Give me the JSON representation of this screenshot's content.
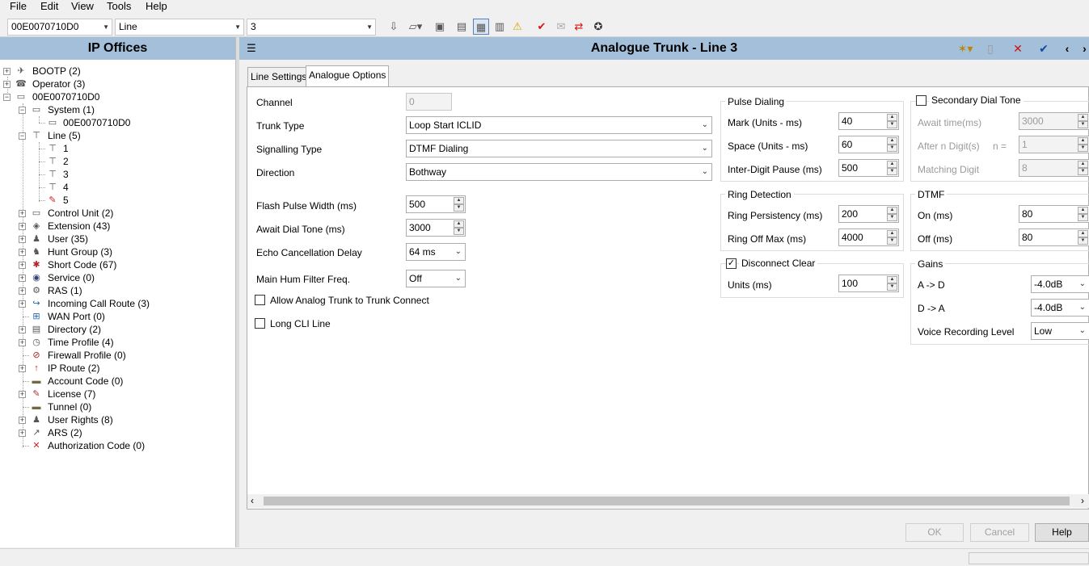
{
  "menu": [
    "File",
    "Edit",
    "View",
    "Tools",
    "Help"
  ],
  "toolbar": {
    "system_select": "00E0070710D0",
    "type_select": "Line",
    "item_select": "3"
  },
  "left_panel": {
    "title": "IP Offices",
    "tree": [
      {
        "label": "BOOTP (2)",
        "icon": "bootp-icon",
        "glyph": "✈"
      },
      {
        "label": "Operator (3)",
        "icon": "operator-icon",
        "glyph": "☎"
      },
      {
        "label": "00E0070710D0",
        "icon": "ip-office-unit-icon",
        "glyph": "▭"
      },
      {
        "label": "System (1)",
        "icon": "system-icon",
        "glyph": "▭"
      },
      {
        "label": "00E0070710D0",
        "icon": "system-unit-icon",
        "glyph": "▭"
      },
      {
        "label": "Line (5)",
        "icon": "line-icon",
        "glyph": "⊤"
      },
      {
        "label": "1",
        "icon": "line-icon",
        "glyph": "⊤"
      },
      {
        "label": "2",
        "icon": "line-icon",
        "glyph": "⊤"
      },
      {
        "label": "3",
        "icon": "line-icon",
        "glyph": "⊤"
      },
      {
        "label": "4",
        "icon": "line-icon",
        "glyph": "⊤"
      },
      {
        "label": "5",
        "icon": "trunk-icon",
        "glyph": "✎"
      },
      {
        "label": "Control Unit (2)",
        "icon": "control-unit-icon",
        "glyph": "▭"
      },
      {
        "label": "Extension (43)",
        "icon": "extension-icon",
        "glyph": "◈"
      },
      {
        "label": "User (35)",
        "icon": "user-icon",
        "glyph": "♟"
      },
      {
        "label": "Hunt Group (3)",
        "icon": "hunt-group-icon",
        "glyph": "♞"
      },
      {
        "label": "Short Code (67)",
        "icon": "short-code-icon",
        "glyph": "✱"
      },
      {
        "label": "Service (0)",
        "icon": "service-icon",
        "glyph": "◉"
      },
      {
        "label": "RAS (1)",
        "icon": "ras-icon",
        "glyph": "⚙"
      },
      {
        "label": "Incoming Call Route (3)",
        "icon": "incoming-call-route-icon",
        "glyph": "↪"
      },
      {
        "label": "WAN Port (0)",
        "icon": "wan-port-icon",
        "glyph": "⊞"
      },
      {
        "label": "Directory (2)",
        "icon": "directory-icon",
        "glyph": "▤"
      },
      {
        "label": "Time Profile (4)",
        "icon": "time-profile-icon",
        "glyph": "◷"
      },
      {
        "label": "Firewall Profile (0)",
        "icon": "firewall-profile-icon",
        "glyph": "⊘"
      },
      {
        "label": "IP Route (2)",
        "icon": "ip-route-icon",
        "glyph": "↑"
      },
      {
        "label": "Account Code (0)",
        "icon": "account-code-icon",
        "glyph": "▬"
      },
      {
        "label": "License (7)",
        "icon": "license-icon",
        "glyph": "✎"
      },
      {
        "label": "Tunnel (0)",
        "icon": "tunnel-icon",
        "glyph": "▬"
      },
      {
        "label": "User Rights (8)",
        "icon": "user-rights-icon",
        "glyph": "♟"
      },
      {
        "label": "ARS (2)",
        "icon": "ars-icon",
        "glyph": "↗"
      },
      {
        "label": "Authorization Code (0)",
        "icon": "authorization-code-icon",
        "glyph": "✕"
      }
    ]
  },
  "right_panel": {
    "title": "Analogue Trunk - Line 3",
    "tabs": [
      "Line Settings",
      "Analogue Options"
    ],
    "fields": {
      "channel": {
        "label": "Channel",
        "value": "0"
      },
      "trunk_type": {
        "label": "Trunk Type",
        "value": "Loop Start ICLID"
      },
      "signalling_type": {
        "label": "Signalling Type",
        "value": "DTMF Dialing"
      },
      "direction": {
        "label": "Direction",
        "value": "Bothway"
      },
      "flash_pulse": {
        "label": "Flash Pulse Width (ms)",
        "value": "500"
      },
      "await_dial_tone": {
        "label": "Await Dial Tone (ms)",
        "value": "3000"
      },
      "echo_cancel": {
        "label": "Echo Cancellation Delay",
        "value": "64 ms"
      },
      "hum_filter": {
        "label": "Main Hum Filter Freq.",
        "value": "Off"
      },
      "allow_analog": {
        "label": "Allow Analog Trunk to Trunk Connect"
      },
      "long_cli": {
        "label": "Long CLI Line"
      }
    },
    "pulse_dialing": {
      "title": "Pulse Dialing",
      "mark_label": "Mark (Units - ms)",
      "mark_value": "40",
      "space_label": "Space (Units - ms)",
      "space_value": "60",
      "inter_digit_label": "Inter-Digit Pause (ms)",
      "inter_digit_value": "500"
    },
    "ring_detection": {
      "title": "Ring Detection",
      "persistency_label": "Ring Persistency (ms)",
      "persistency_value": "200",
      "off_max_label": "Ring Off Max (ms)",
      "off_max_value": "4000"
    },
    "disconnect_clear": {
      "title": "Disconnect Clear",
      "units_label": "Units (ms)",
      "units_value": "100"
    },
    "secondary_dial_tone": {
      "title": "Secondary Dial Tone",
      "await_label": "Await time(ms)",
      "await_value": "3000",
      "after_label": "After n Digit(s)",
      "n_label": "n =",
      "after_value": "1",
      "matching_label": "Matching Digit",
      "matching_value": "8"
    },
    "dtmf": {
      "title": "DTMF",
      "on_label": "On (ms)",
      "on_value": "80",
      "off_label": "Off (ms)",
      "off_value": "80"
    },
    "gains": {
      "title": "Gains",
      "a_to_d_label": "A -> D",
      "a_to_d_value": "-4.0dB",
      "d_to_a_label": "D -> A",
      "d_to_a_value": "-4.0dB",
      "voice_label": "Voice Recording Level",
      "voice_value": "Low"
    },
    "buttons": {
      "ok": "OK",
      "cancel": "Cancel",
      "help": "Help"
    }
  }
}
